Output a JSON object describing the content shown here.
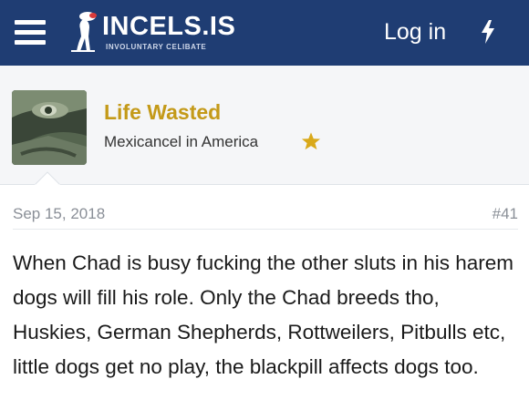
{
  "header": {
    "logo_title": "INCELS.IS",
    "logo_subtitle": "INVOLUNTARY CELIBATE",
    "login_label": "Log in",
    "menu_icon": "hamburger-icon",
    "whats_new_icon": "bolt-icon",
    "bg_color": "#1f3d73"
  },
  "user": {
    "name": "Life Wasted",
    "title": "Mexicancel in America",
    "badge_icon": "star-icon",
    "name_color": "#c49a19"
  },
  "post": {
    "date": "Sep 15, 2018",
    "number": "#41",
    "body": "When Chad is busy fucking the other sluts in his harem dogs will fill his role. Only the Chad breeds tho, Huskies, German Shepherds, Rottweilers, Pitbulls etc, little dogs get no play, the blackpill affects dogs too."
  }
}
